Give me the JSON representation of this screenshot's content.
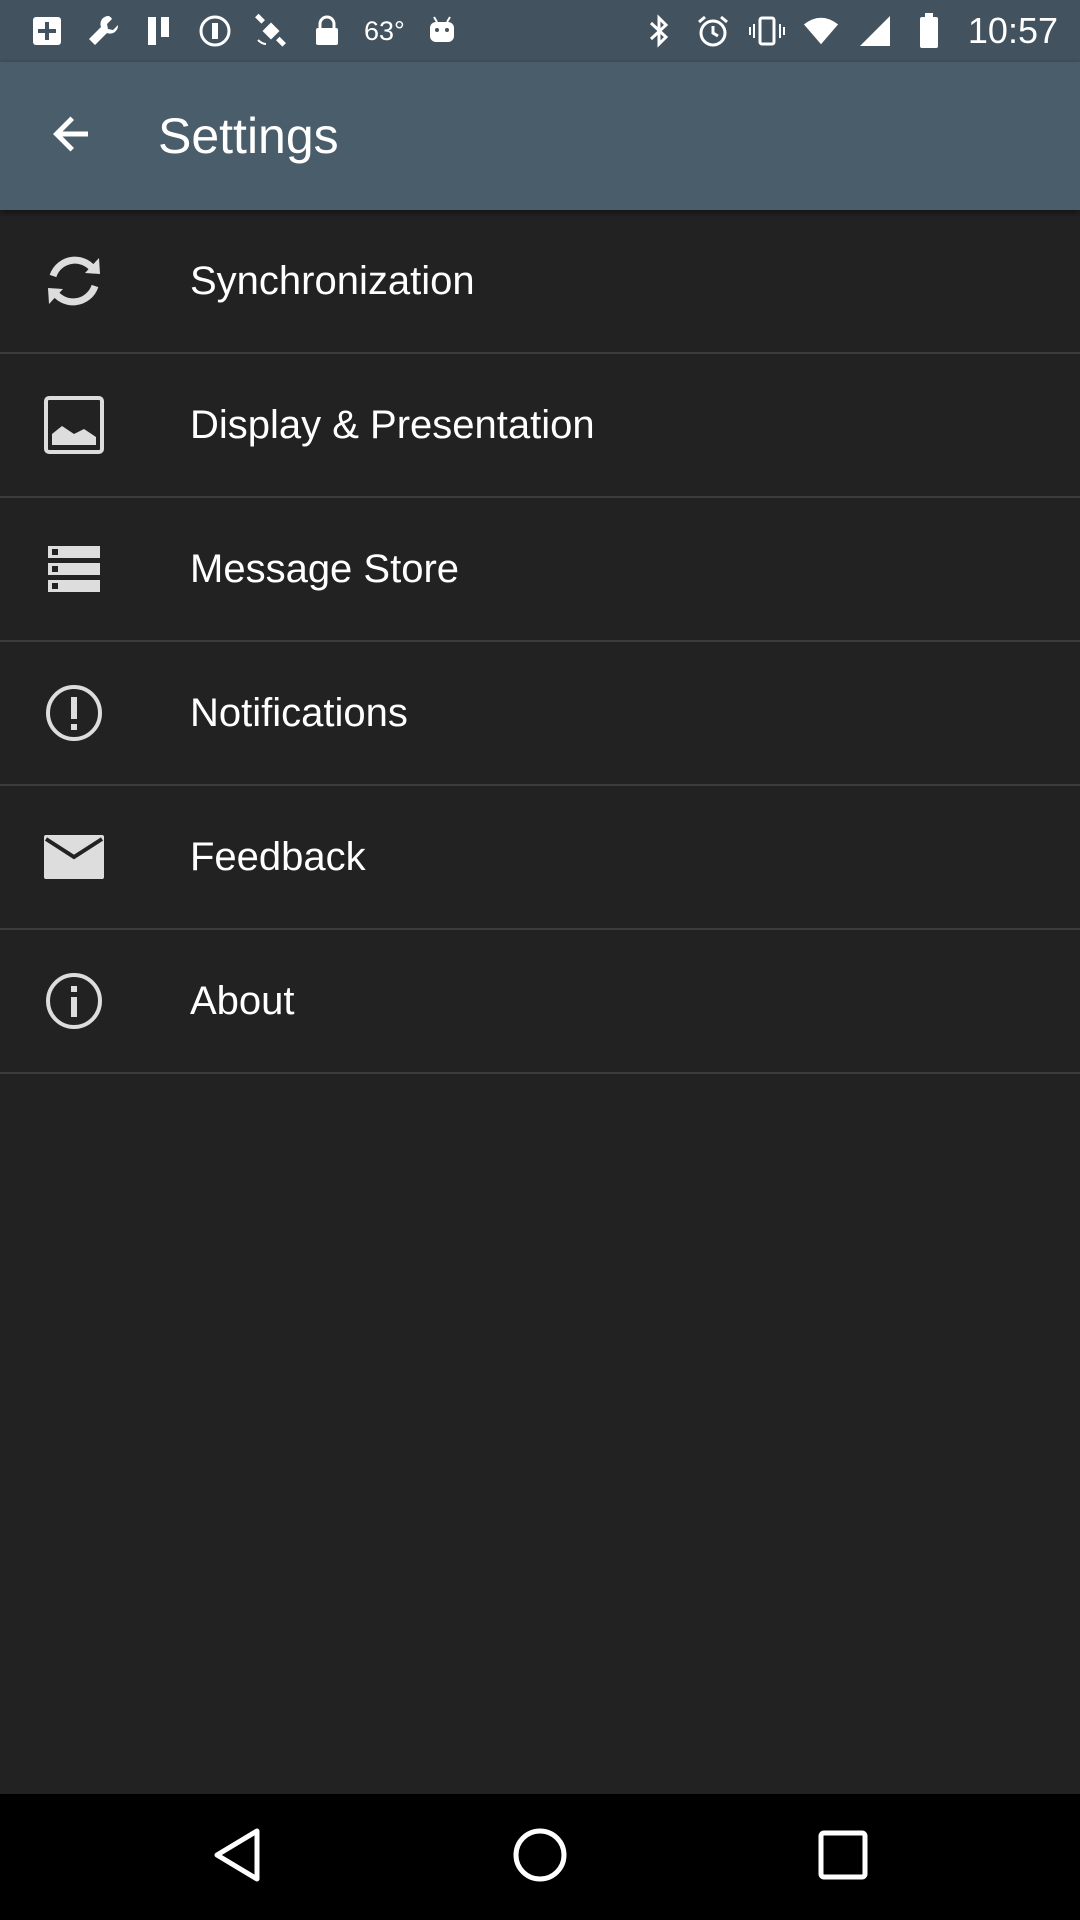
{
  "status_bar": {
    "left_icons": [
      "add-box-icon",
      "wrench-icon",
      "pause-icon",
      "stop-circle-icon",
      "fake-gps-icon",
      "lock-icon"
    ],
    "temperature": "63°",
    "right_icons": [
      "bluetooth-icon",
      "alarm-icon",
      "vibrate-icon",
      "wifi-icon",
      "signal-icon",
      "battery-icon"
    ],
    "time": "10:57"
  },
  "app_bar": {
    "back_icon": "arrow-back-icon",
    "title": "Settings"
  },
  "settings": {
    "items": [
      {
        "label": "Synchronization",
        "icon": "sync-icon"
      },
      {
        "label": "Display & Presentation",
        "icon": "image-icon"
      },
      {
        "label": "Message Store",
        "icon": "storage-icon"
      },
      {
        "label": "Notifications",
        "icon": "alert-circle-icon"
      },
      {
        "label": "Feedback",
        "icon": "mail-icon"
      },
      {
        "label": "About",
        "icon": "info-icon"
      }
    ]
  },
  "nav_bar": {
    "buttons": [
      "back-triangle-icon",
      "home-circle-icon",
      "recents-square-icon"
    ]
  },
  "colors": {
    "status_bar": "#42525f",
    "app_bar": "#4a5d6a",
    "background": "#222222",
    "divider": "#3c3c3c",
    "nav_bar": "#000000",
    "text": "#ffffff",
    "icon": "#dddddd"
  }
}
